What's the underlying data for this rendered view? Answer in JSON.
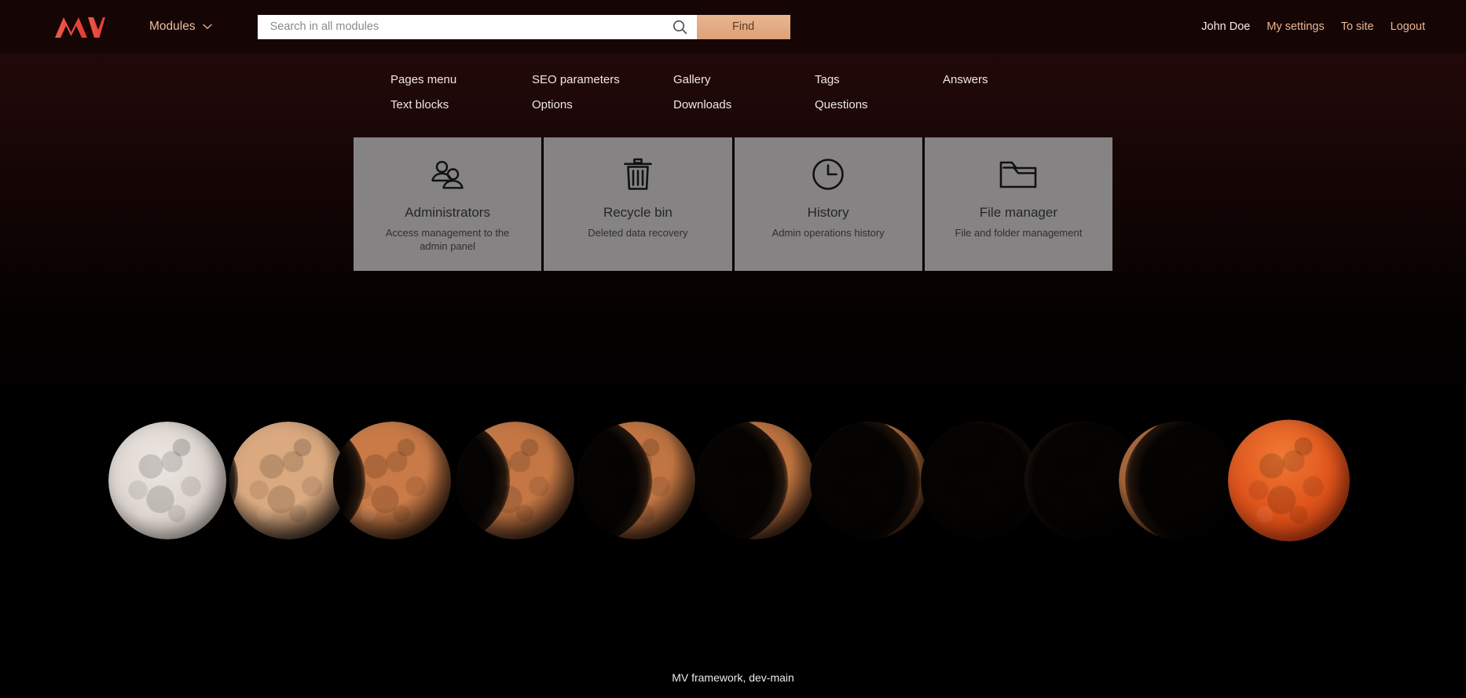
{
  "brand": {
    "logo_text": "MV",
    "logo_color": "#e8453c",
    "accent_color": "#e8b694",
    "card_bg_color": "#858383",
    "background_color": "#1b0707"
  },
  "topbar": {
    "modules_label": "Modules",
    "modules_chevron_icon": "chevron-down-icon",
    "search": {
      "placeholder": "Search in all modules",
      "value": "",
      "icon": "search-icon",
      "find_label": "Find"
    },
    "user_name": "John Doe",
    "links": [
      {
        "label": "My settings"
      },
      {
        "label": "To site"
      },
      {
        "label": "Logout"
      }
    ]
  },
  "modules_menu": {
    "columns": [
      {
        "items": [
          "Pages menu",
          "Text blocks"
        ]
      },
      {
        "items": [
          "SEO parameters",
          "Options"
        ]
      },
      {
        "items": [
          "Gallery",
          "Downloads"
        ]
      },
      {
        "items": [
          "Tags",
          "Questions"
        ]
      },
      {
        "items": [
          "Answers"
        ]
      }
    ],
    "rows": [
      [
        "Pages menu",
        "SEO parameters",
        "Gallery",
        "Tags",
        "Answers"
      ],
      [
        "Text blocks",
        "Options",
        "Downloads",
        "Questions",
        ""
      ]
    ]
  },
  "cards": [
    {
      "icon": "users-icon",
      "title": "Administrators",
      "description": "Access management to the admin panel"
    },
    {
      "icon": "trash-icon",
      "title": "Recycle bin",
      "description": "Deleted data recovery"
    },
    {
      "icon": "clock-icon",
      "title": "History",
      "description": "Admin operations history"
    },
    {
      "icon": "folder-icon",
      "title": "File manager",
      "description": "File and folder management"
    }
  ],
  "hero": {
    "alt": "lunar-eclipse-sequence",
    "phases": [
      {
        "index": 1,
        "tint": "#d8d0cb",
        "shadow_fraction": 0.0,
        "label": "full-moon-bright"
      },
      {
        "index": 2,
        "tint": "#d9a97e",
        "shadow_fraction": 0.05,
        "label": "penumbral"
      },
      {
        "index": 3,
        "tint": "#c9713f",
        "shadow_fraction": 0.18,
        "label": "partial-1"
      },
      {
        "index": 4,
        "tint": "#c2apa",
        "shadow_fraction": 0.3,
        "label": "partial-2"
      },
      {
        "index": 5,
        "tint": "#bf7a4c",
        "shadow_fraction": 0.42,
        "label": "partial-3"
      },
      {
        "index": 6,
        "tint": "#bb7448",
        "shadow_fraction": 0.52,
        "label": "partial-4"
      },
      {
        "index": 7,
        "tint": "#b87046",
        "shadow_fraction": 0.62,
        "label": "partial-5"
      },
      {
        "index": 8,
        "tint": "#b46c44",
        "shadow_fraction": 0.7,
        "label": "partial-6"
      },
      {
        "index": 9,
        "tint": "#b06842",
        "shadow_fraction": 0.78,
        "label": "partial-7"
      },
      {
        "index": 10,
        "tint": "#ab6440",
        "shadow_fraction": 0.86,
        "label": "partial-8"
      },
      {
        "index": 11,
        "tint": "#d64a18",
        "shadow_fraction": 0.0,
        "label": "totality-blood-moon"
      }
    ]
  },
  "footer": {
    "text": "MV framework, dev-main"
  }
}
